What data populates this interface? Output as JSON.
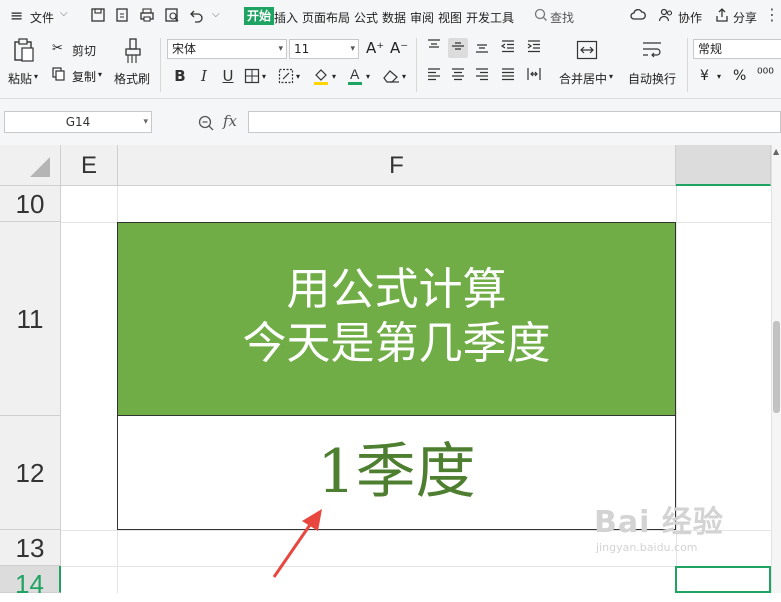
{
  "menubar": {
    "hamburger": "≡",
    "file_label": "文件",
    "tabs": [
      "开始",
      "插入",
      "页面布局",
      "公式",
      "数据",
      "审阅",
      "视图",
      "开发工具"
    ],
    "search_label": "查找",
    "collab_label": "协作",
    "share_label": "分享"
  },
  "ribbon": {
    "paste_label": "粘贴",
    "cut_label": "剪切",
    "copy_label": "复制",
    "format_painter_label": "格式刷",
    "font_name": "宋体",
    "font_size": "11",
    "font_grow": "A⁺",
    "font_shrink": "A⁻",
    "bold": "B",
    "italic": "I",
    "underline": "U",
    "merge_center_label": "合并居中",
    "wrap_text_label": "自动换行",
    "number_format": "常规",
    "currency_symbol": "¥",
    "percent_symbol": "%",
    "thousands_symbol": "⁰⁰⁰"
  },
  "formula_bar": {
    "cell_ref": "G14",
    "fx_label": "fx",
    "formula_value": ""
  },
  "sheet": {
    "columns": [
      "E",
      "F"
    ],
    "rows": [
      "10",
      "11",
      "12",
      "13",
      "14"
    ],
    "title_line1": "用公式计算",
    "title_line2": "今天是第几季度",
    "result": "1季度"
  },
  "watermark": {
    "brand": "Bai 经验",
    "url": "jingyan.baidu.com"
  },
  "colors": {
    "accent": "#1ea362",
    "title_fill": "#70ad47",
    "result_text": "#4e7f30",
    "arrow": "#e8473f"
  }
}
